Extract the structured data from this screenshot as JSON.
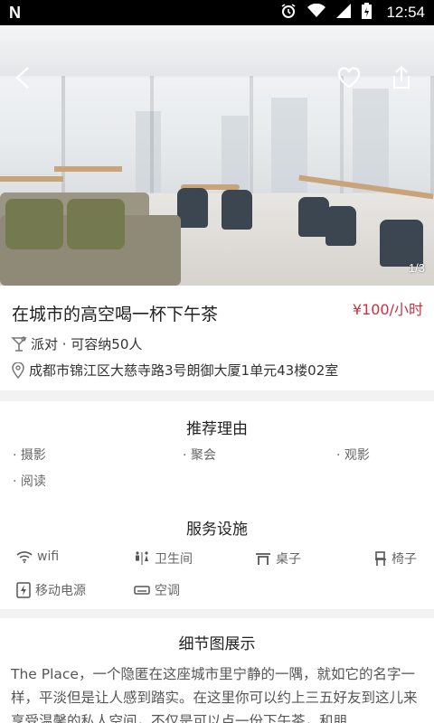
{
  "status": {
    "time": "12:54",
    "app_mark": "N"
  },
  "hero": {
    "pager": "1/3"
  },
  "venue": {
    "title": "在城市的高空喝一杯下午茶",
    "price": "¥100/小时",
    "type_capacity": "派对 · 可容纳50人",
    "address": "成都市锦江区大慈寺路3号朗御大厦1单元43楼02室"
  },
  "reasons": {
    "heading": "推荐理由",
    "items": [
      "摄影",
      "聚会",
      "观影",
      "阅读"
    ]
  },
  "facilities": {
    "heading": "服务设施",
    "items": [
      {
        "label": "wifi",
        "icon": "wifi-icon"
      },
      {
        "label": "卫生间",
        "icon": "restroom-icon"
      },
      {
        "label": "桌子",
        "icon": "table-icon"
      },
      {
        "label": "椅子",
        "icon": "chair-icon"
      },
      {
        "label": "移动电源",
        "icon": "power-bank-icon"
      },
      {
        "label": "空调",
        "icon": "air-conditioner-icon"
      }
    ]
  },
  "details": {
    "heading": "细节图展示",
    "description": "The Place，一个隐匿在这座城市里宁静的一隅，就如它的名字一样，平淡但是让人感到踏实。在这里你可以约上三五好友到这儿来享受温馨的私人空间，不仅是可以点一份下午茶，和朋"
  },
  "colors": {
    "accent": "#c8323c",
    "section_bg": "#f2f2f2"
  }
}
